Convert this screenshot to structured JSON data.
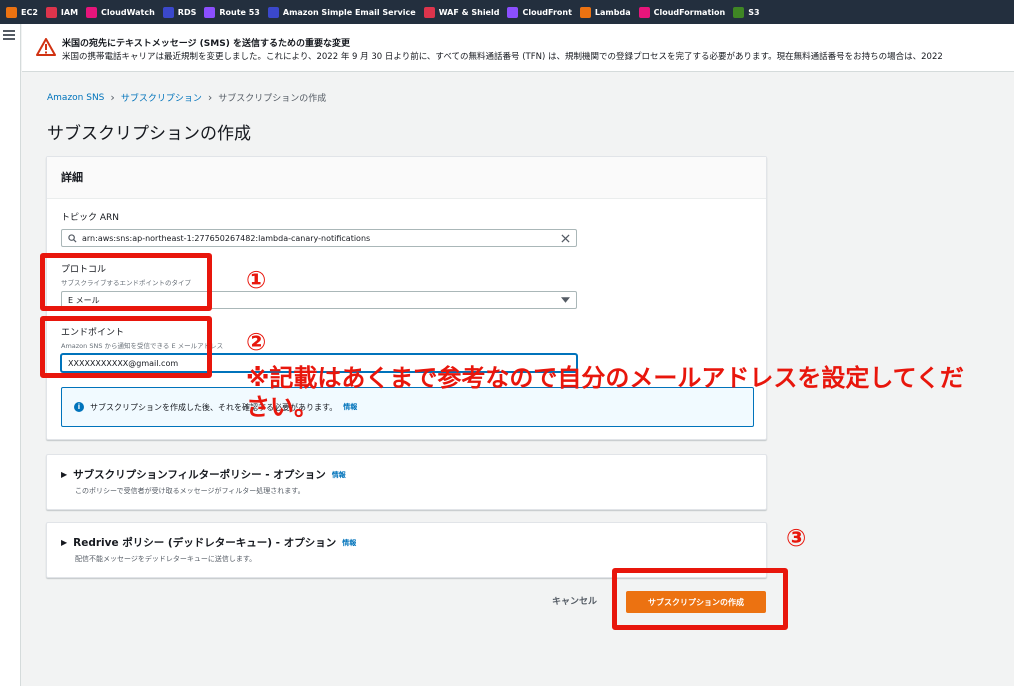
{
  "bookmarks": [
    {
      "label": "EC2",
      "color": "#ec7211"
    },
    {
      "label": "IAM",
      "color": "#dd344c"
    },
    {
      "label": "CloudWatch",
      "color": "#e7157b"
    },
    {
      "label": "RDS",
      "color": "#3b48cc"
    },
    {
      "label": "Route 53",
      "color": "#8c4fff"
    },
    {
      "label": "Amazon Simple Email Service",
      "color": "#3b48cc"
    },
    {
      "label": "WAF & Shield",
      "color": "#dd344c"
    },
    {
      "label": "CloudFront",
      "color": "#8c4fff"
    },
    {
      "label": "Lambda",
      "color": "#ec7211"
    },
    {
      "label": "CloudFormation",
      "color": "#e7157b"
    },
    {
      "label": "S3",
      "color": "#3f8624"
    }
  ],
  "banner": {
    "title": "米国の宛先にテキストメッセージ (SMS) を送信するための重要な変更",
    "body": "米国の携帯電話キャリアは最近規制を変更しました。これにより、2022 年 9 月 30 日より前に、すべての無料通話番号 (TFN) は、規制機関での登録プロセスを完了する必要があります。現在無料通話番号をお持ちの場合は、2022"
  },
  "breadcrumb": {
    "item1": "Amazon SNS",
    "item2": "サブスクリプション",
    "current": "サブスクリプションの作成"
  },
  "page_title": "サブスクリプションの作成",
  "details": {
    "header": "詳細",
    "topic_arn_label": "トピック ARN",
    "topic_arn_value": "arn:aws:sns:ap-northeast-1:277650267482:lambda-canary-notifications",
    "protocol_label": "プロトコル",
    "protocol_desc": "サブスクライブするエンドポイントのタイプ",
    "protocol_value": "E メール",
    "endpoint_label": "エンドポイント",
    "endpoint_desc": "Amazon SNS から通知を受信できる E メールアドレス",
    "endpoint_value": "XXXXXXXXXXX@gmail.com",
    "info_text": "サブスクリプションを作成した後、それを確認する必要があります。",
    "info_link": "情報"
  },
  "filter_policy": {
    "title": "サブスクリプションフィルターポリシー - オプション",
    "info": "情報",
    "desc": "このポリシーで受信者が受け取るメッセージがフィルター処理されます。"
  },
  "redrive_policy": {
    "title": "Redrive ポリシー (デッドレターキュー) - オプション",
    "info": "情報",
    "desc": "配信不能メッセージをデッドレターキューに送信します。"
  },
  "actions": {
    "cancel": "キャンセル",
    "create": "サブスクリプションの作成"
  },
  "annotations": {
    "num1": "①",
    "num2": "②",
    "num3": "③",
    "note": "※記載はあくまで参考なので自分のメールアドレスを設定してください。",
    "color": "#e8160c"
  }
}
